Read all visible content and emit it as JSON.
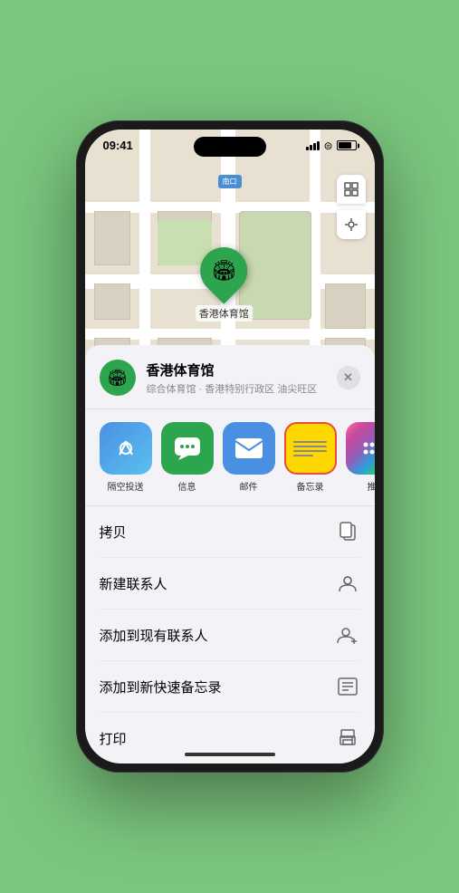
{
  "status_bar": {
    "time": "09:41",
    "location_arrow": "▶"
  },
  "map": {
    "label": "南口",
    "pin_emoji": "🏟",
    "stadium_name": "香港体育馆"
  },
  "location_card": {
    "name": "香港体育馆",
    "subtitle": "综合体育馆 · 香港特别行政区 油尖旺区",
    "close_label": "✕"
  },
  "share_items": [
    {
      "id": "airdrop",
      "label": "隔空投送",
      "type": "airdrop"
    },
    {
      "id": "message",
      "label": "信息",
      "type": "message"
    },
    {
      "id": "mail",
      "label": "邮件",
      "type": "mail"
    },
    {
      "id": "notes",
      "label": "备忘录",
      "type": "notes"
    },
    {
      "id": "more",
      "label": "推",
      "type": "more"
    }
  ],
  "actions": [
    {
      "id": "copy",
      "label": "拷贝",
      "icon": "copy"
    },
    {
      "id": "new-contact",
      "label": "新建联系人",
      "icon": "person"
    },
    {
      "id": "add-contact",
      "label": "添加到现有联系人",
      "icon": "person-add"
    },
    {
      "id": "add-note",
      "label": "添加到新快速备忘录",
      "icon": "note"
    },
    {
      "id": "print",
      "label": "打印",
      "icon": "print"
    }
  ],
  "icons": {
    "copy": "⊕",
    "person": "👤",
    "person_add": "👤",
    "note": "📋",
    "print": "🖨"
  }
}
